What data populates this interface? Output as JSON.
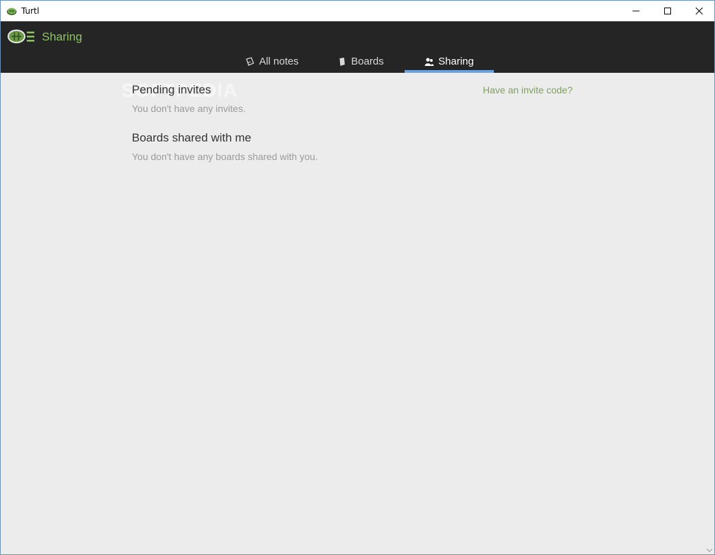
{
  "window": {
    "title": "Turtl",
    "icons": {
      "app": "turtle-icon",
      "minimize": "minimize-icon",
      "maximize": "maximize-icon",
      "close": "close-icon"
    }
  },
  "header": {
    "section_title": "Sharing",
    "logo_icon": "turtl-logo-icon",
    "tabs": [
      {
        "label": "All notes",
        "icon": "notes-icon",
        "active": false
      },
      {
        "label": "Boards",
        "icon": "book-icon",
        "active": false
      },
      {
        "label": "Sharing",
        "icon": "users-icon",
        "active": true
      }
    ]
  },
  "main": {
    "pending": {
      "heading": "Pending invites",
      "empty_text": "You don't have any invites."
    },
    "shared": {
      "heading": "Boards shared with me",
      "empty_text": "You don't have any boards shared with you."
    },
    "invite_link": "Have an invite code?",
    "watermark": "SOFTPEDIA"
  },
  "colors": {
    "header_bg": "#252525",
    "accent_green": "#8fc26a",
    "link_green": "#7fa05e",
    "tab_underline": "#6aa0e0",
    "content_bg": "#ececec"
  }
}
